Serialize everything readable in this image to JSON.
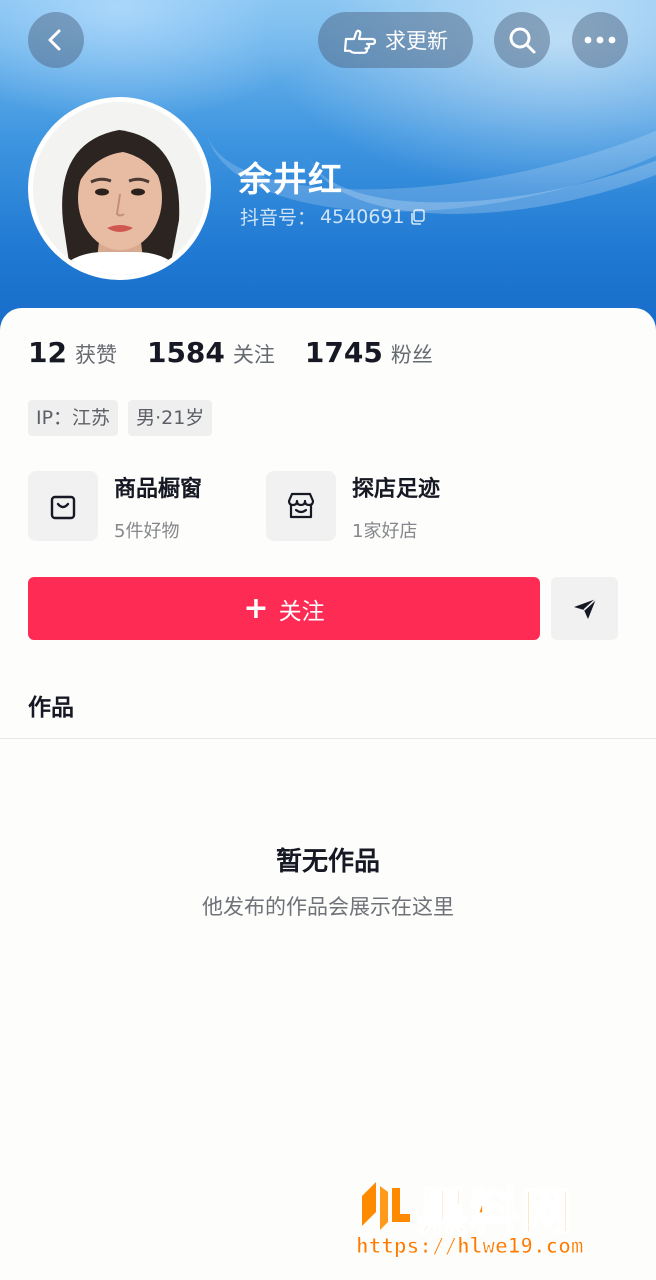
{
  "header": {
    "request_update_label": "求更新",
    "username": "余井红",
    "douyin_id_label": "抖音号：",
    "douyin_id_value": "4540691"
  },
  "stats": [
    {
      "value": "12",
      "label": "获赞"
    },
    {
      "value": "1584",
      "label": "关注"
    },
    {
      "value": "1745",
      "label": "粉丝"
    }
  ],
  "tags": [
    {
      "label": "IP：江苏"
    },
    {
      "label": "男·21岁"
    }
  ],
  "features": [
    {
      "title": "商品橱窗",
      "subtitle": "5件好物",
      "icon": "shopping-bag-icon"
    },
    {
      "title": "探店足迹",
      "subtitle": "1家好店",
      "icon": "store-icon"
    }
  ],
  "actions": {
    "follow_plus": "+",
    "follow_label": "关注"
  },
  "tabs": {
    "works_label": "作品"
  },
  "empty_state": {
    "title": "暂无作品",
    "subtitle": "他发布的作品会展示在这里"
  },
  "watermark": {
    "brand": "黑料网",
    "url": "https://hlwe19.com"
  },
  "colors": {
    "accent": "#fe2c55",
    "banner_blue": "#1f78d2",
    "watermark_orange": "#ff8a00"
  },
  "icons": [
    "back-icon",
    "pointing-hand-icon",
    "search-icon",
    "more-icon",
    "copy-icon",
    "shopping-bag-icon",
    "store-icon",
    "share-icon"
  ]
}
